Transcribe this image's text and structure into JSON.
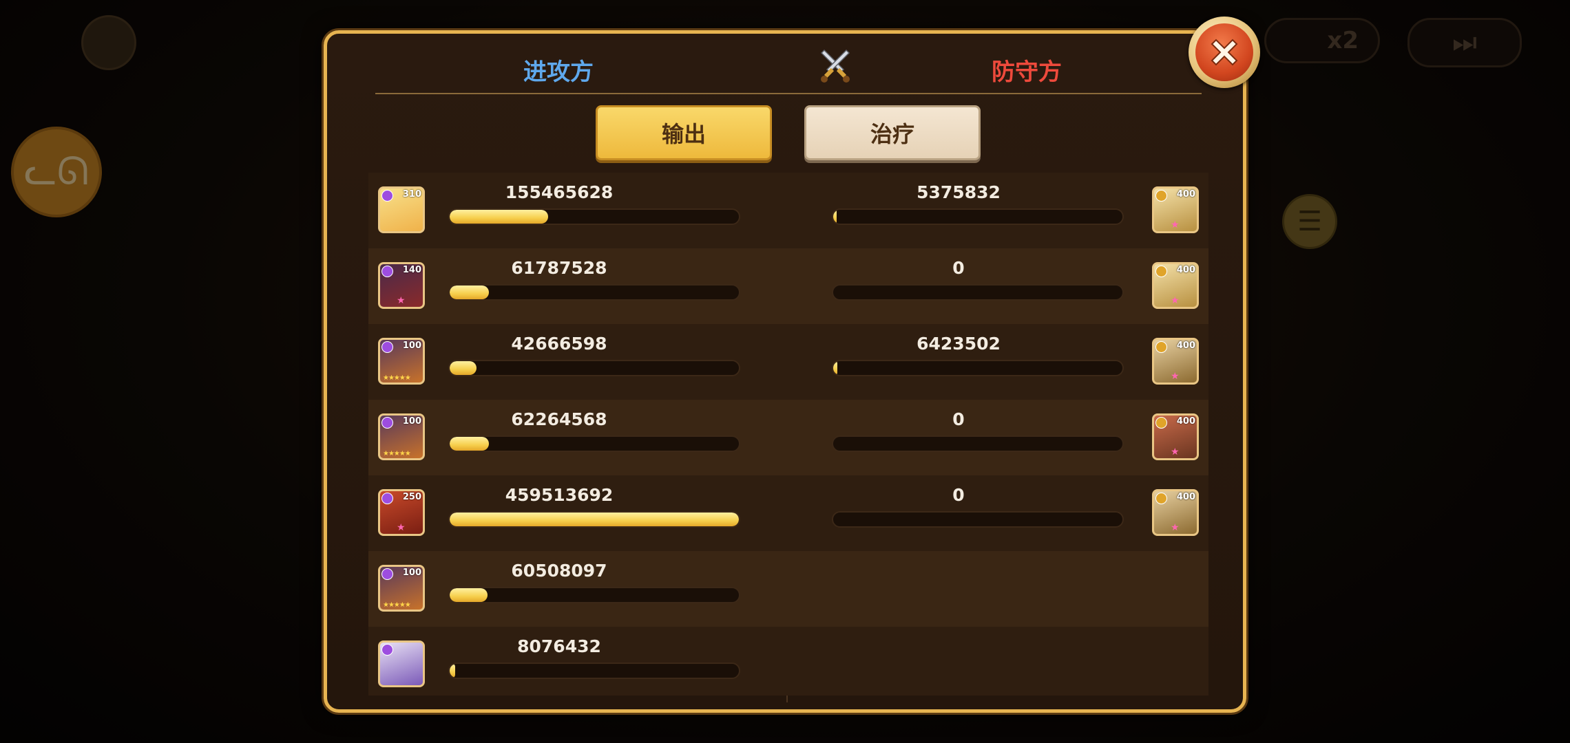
{
  "background": {
    "speed_label": "x2",
    "scene_color": "#120c08"
  },
  "panel": {
    "attacker_title": "进攻方",
    "defender_title": "防守方",
    "tabs": [
      {
        "label": "输出",
        "active": true
      },
      {
        "label": "治疗",
        "active": false
      }
    ],
    "close_icon": "close-icon",
    "swords_icon": "crossed-swords-icon",
    "colors": {
      "attacker": "#5fa8ec",
      "defender": "#ee4a3c",
      "bar_fill": "#f6cf4c",
      "border": "#e7b451"
    }
  },
  "attackers": [
    {
      "value": "155465628",
      "level": "310",
      "ratio": 0.34,
      "portrait": "blonde-hero",
      "stars": ""
    },
    {
      "value": "61787528",
      "level": "140",
      "ratio": 0.135,
      "portrait": "masked-ninja",
      "stars": "pink"
    },
    {
      "value": "42666598",
      "level": "100",
      "ratio": 0.093,
      "portrait": "orange-masked",
      "stars": "★★★★★"
    },
    {
      "value": "62264568",
      "level": "100",
      "ratio": 0.136,
      "portrait": "orange-masked",
      "stars": "★★★★★"
    },
    {
      "value": "459513692",
      "level": "250",
      "ratio": 1.0,
      "portrait": "red-dragon",
      "stars": "pink"
    },
    {
      "value": "60508097",
      "level": "100",
      "ratio": 0.132,
      "portrait": "orange-masked",
      "stars": "★★★★★"
    },
    {
      "value": "8076432",
      "level": "",
      "ratio": 0.018,
      "portrait": "white-spirit",
      "stars": ""
    }
  ],
  "defenders": [
    {
      "value": "5375832",
      "level": "400",
      "ratio": 0.012,
      "portrait": "gold-golem"
    },
    {
      "value": "0",
      "level": "400",
      "ratio": 0,
      "portrait": "gold-golem"
    },
    {
      "value": "6423502",
      "level": "400",
      "ratio": 0.014,
      "portrait": "gold-robot"
    },
    {
      "value": "0",
      "level": "400",
      "ratio": 0,
      "portrait": "red-dragon-golem"
    },
    {
      "value": "0",
      "level": "400",
      "ratio": 0,
      "portrait": "gold-robot"
    }
  ]
}
